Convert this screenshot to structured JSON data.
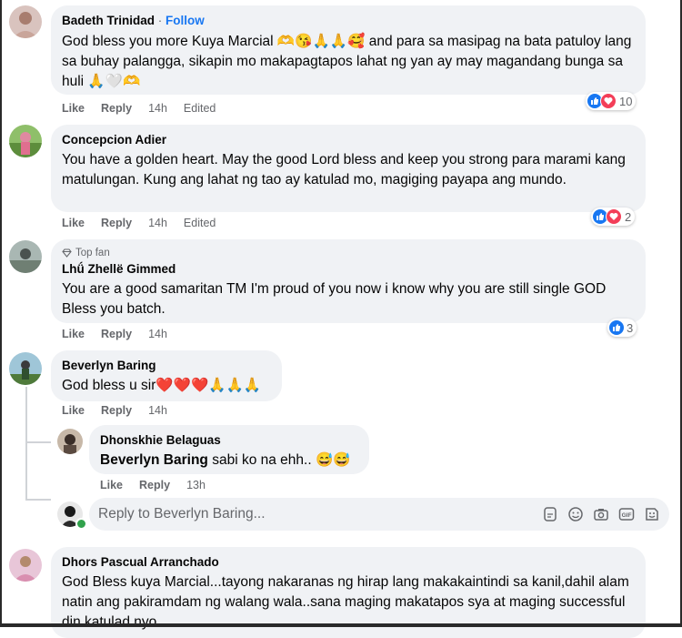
{
  "comments": [
    {
      "author": "Badeth Trinidad",
      "separator": " · ",
      "follow_label": "Follow",
      "text": "God bless you more Kuya Marcial 🫶😘🙏🙏🥰 and para sa masipag na bata patuloy lang sa buhay palangga, sikapin mo makapagtapos lahat ng yan ay may magandang bunga sa huli 🙏🤍🫶",
      "actions": {
        "like": "Like",
        "reply": "Reply",
        "time": "14h",
        "edited": "Edited"
      },
      "reaction_count": "10"
    },
    {
      "author": "Concepcion Adier",
      "text": "You have a golden heart. May the good Lord bless and keep you strong para marami kang matulungan. Kung ang lahat ng tao ay katulad mo, magiging payapa ang mundo.",
      "actions": {
        "like": "Like",
        "reply": "Reply",
        "time": "14h",
        "edited": "Edited"
      },
      "reaction_count": "2"
    },
    {
      "badge": "Top fan",
      "author": "Lhǘ Zhellë Gimmed",
      "text": "You are a good samaritan TM I'm proud of you now i know why you are still single GOD Bless you batch.",
      "actions": {
        "like": "Like",
        "reply": "Reply",
        "time": "14h"
      },
      "reaction_count": "3"
    },
    {
      "author": "Beverlyn Baring",
      "text": "God bless u sir❤️❤️❤️🙏🙏🙏",
      "actions": {
        "like": "Like",
        "reply": "Reply",
        "time": "14h"
      }
    },
    {
      "author": "Dhors Pascual Arranchado",
      "text": "God Bless kuya Marcial...tayong nakaranas ng hirap lang makakaintindi sa kanil,dahil alam natin ang pakiramdam ng walang wala..sana maging makatapos sya at maging successful din katulad nyo."
    }
  ],
  "reply": {
    "author": "Dhonskhie Belaguas",
    "mention": "Beverlyn Baring",
    "text": " sabi ko na ehh.. 😅😅",
    "actions": {
      "like": "Like",
      "reply": "Reply",
      "time": "13h"
    }
  },
  "reply_box": {
    "placeholder": "Reply to Beverlyn Baring..."
  },
  "icons": {
    "like": "like-reaction-icon",
    "love": "love-reaction-icon",
    "top_fan": "diamond-icon",
    "sticker": "sticker-icon",
    "emoji": "emoji-icon",
    "camera": "camera-icon",
    "gif": "gif-icon",
    "avatar_sticker": "avatar-sticker-icon"
  },
  "colors": {
    "accent": "#1877f2",
    "bubble": "#f0f2f5",
    "muted": "#65676b",
    "love": "#f33e58"
  }
}
